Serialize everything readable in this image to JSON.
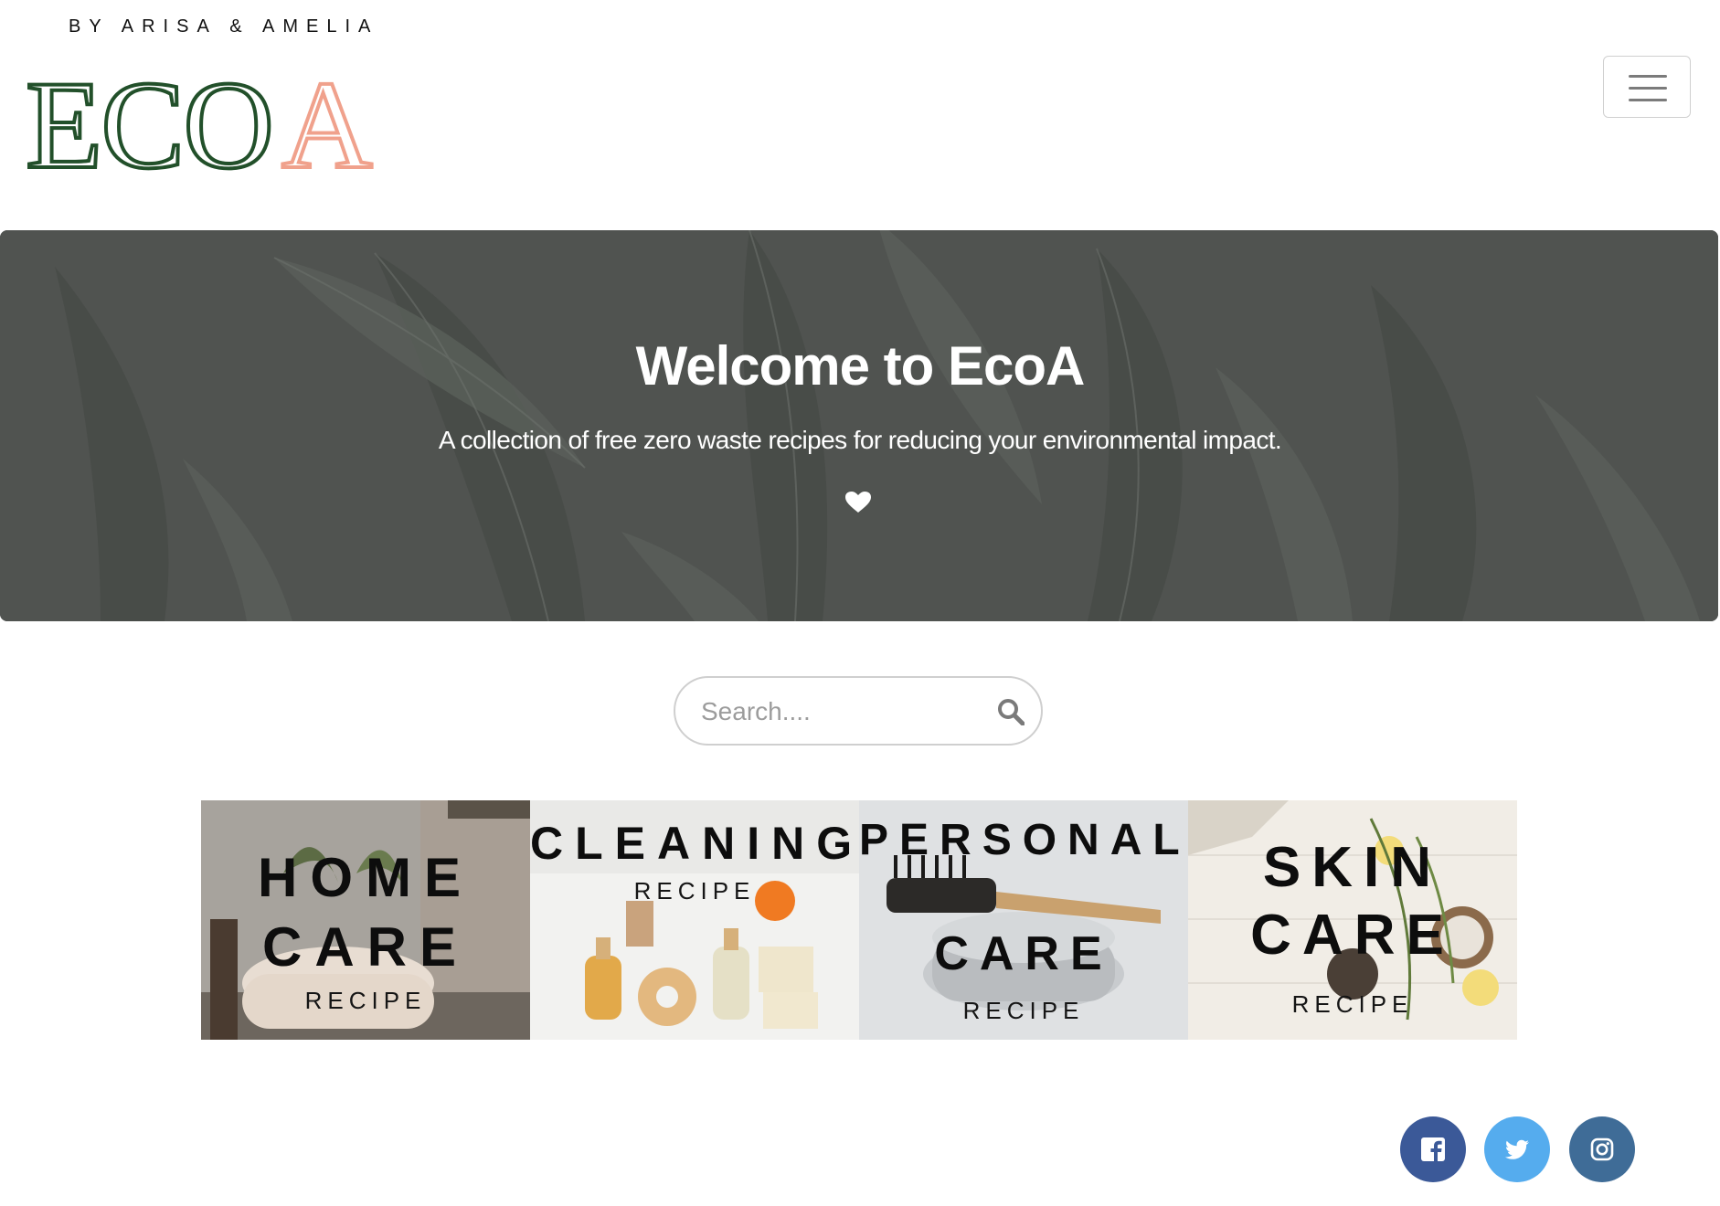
{
  "brand": {
    "tagline": "BY ARISA & AMELIA",
    "logo_main": "ECO",
    "logo_accent": "A",
    "logo_color": "#22502a",
    "accent_color": "#f0a18c"
  },
  "header": {
    "menu_icon": "hamburger-icon"
  },
  "hero": {
    "title": "Welcome to EcoA",
    "subtitle": "A collection of free zero waste recipes for reducing your environmental impact.",
    "icon": "heart-icon"
  },
  "search": {
    "placeholder": "Search....",
    "value": "",
    "icon": "search-icon"
  },
  "categories": [
    {
      "line1": "HOME",
      "line2": "CARE",
      "sub": "RECIPE"
    },
    {
      "line1": "CLEANING",
      "sub": "RECIPE"
    },
    {
      "line1": "PERSONAL",
      "line2": "CARE",
      "sub": "RECIPE"
    },
    {
      "line1": "SKIN",
      "line2": "CARE",
      "sub": "RECIPE"
    }
  ],
  "social": [
    {
      "name": "facebook",
      "icon": "facebook-icon",
      "color": "#3b5998"
    },
    {
      "name": "twitter",
      "icon": "twitter-icon",
      "color": "#55acee"
    },
    {
      "name": "instagram",
      "icon": "instagram-icon",
      "color": "#3f6c97"
    }
  ]
}
